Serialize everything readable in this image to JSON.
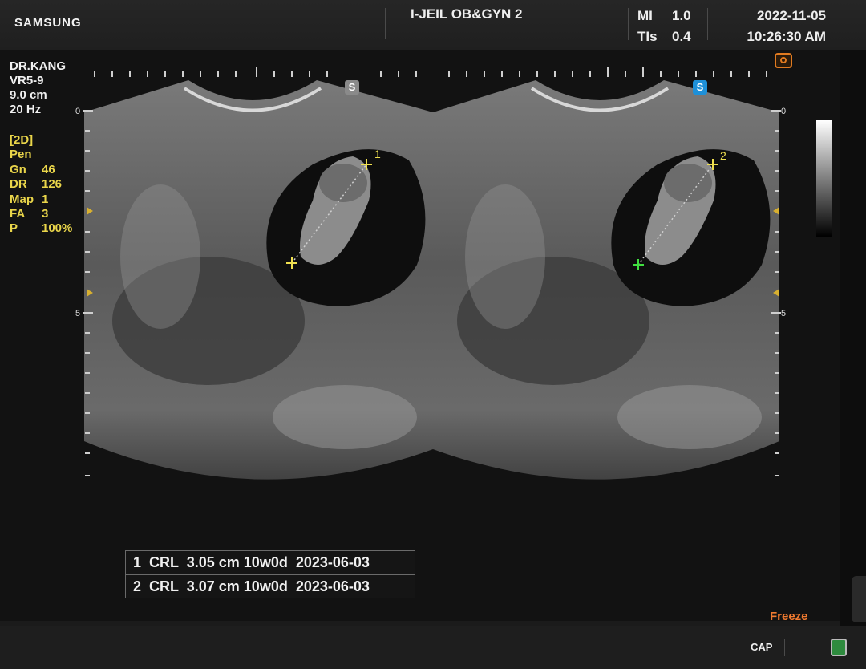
{
  "header": {
    "brand": "SAMSUNG",
    "hospital": "I-JEIL OB&GYN 2",
    "mi_label": "MI",
    "mi_value": "1.0",
    "tis_label": "TIs",
    "tis_value": "0.4",
    "date": "2022-11-05",
    "time": "10:26:30 AM"
  },
  "probe_info": {
    "operator": "DR.KANG",
    "probe": "VR5-9",
    "depth": "9.0 cm",
    "frame_rate": "20 Hz"
  },
  "params": [
    {
      "k": "[2D]",
      "v": ""
    },
    {
      "k": "Pen",
      "v": ""
    },
    {
      "k": "Gn",
      "v": "46"
    },
    {
      "k": "DR",
      "v": "126"
    },
    {
      "k": "Map",
      "v": "1"
    },
    {
      "k": "FA",
      "v": "3"
    },
    {
      "k": "P",
      "v": "100%"
    }
  ],
  "depth_scale": {
    "top": "0",
    "mid": "5"
  },
  "image_panels": [
    {
      "orientation_mark": "S",
      "mark_color": "#8a8a8a",
      "caliper_label": "1"
    },
    {
      "orientation_mark": "S",
      "mark_color": "#1e90d8",
      "caliper_label": "2"
    }
  ],
  "measurements": [
    {
      "index": "1",
      "type": "CRL",
      "value": "3.05 cm",
      "ga": "10w0d",
      "edd": "2023-06-03"
    },
    {
      "index": "2",
      "type": "CRL",
      "value": "3.07 cm",
      "ga": "10w0d",
      "edd": "2023-06-03"
    }
  ],
  "status": {
    "freeze_label": "Freeze",
    "cap_label": "CAP"
  },
  "icons": [
    "freeze-cine-icon",
    "battery-icon"
  ],
  "colors": {
    "caliper_start": "#f0e050",
    "caliper_end": "#40e040",
    "freeze": "#f07a30",
    "params": "#e9d54a"
  }
}
